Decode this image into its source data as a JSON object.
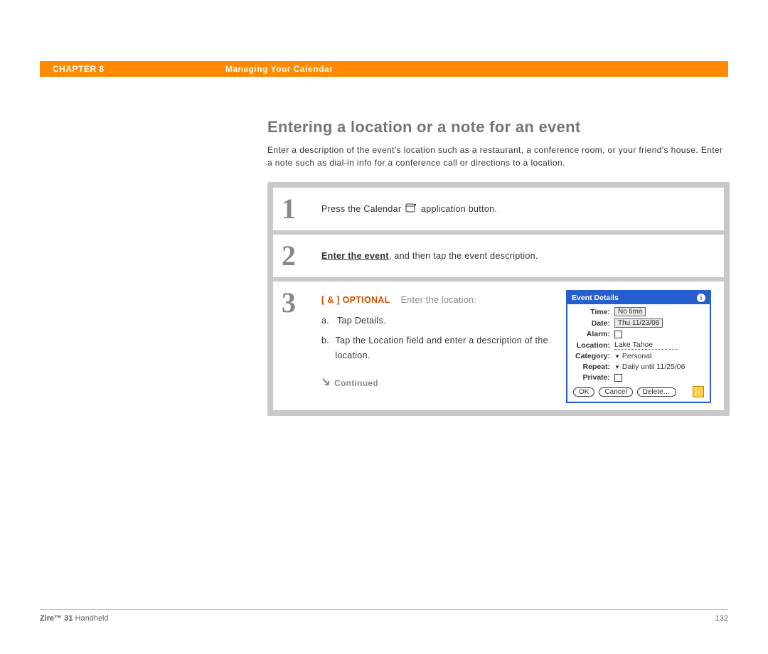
{
  "header": {
    "chapter": "CHAPTER 8",
    "title": "Managing Your Calendar"
  },
  "page": {
    "heading": "Entering a location or a note for an event",
    "intro": "Enter a description of the event's location such as a restaurant, a conference room, or your friend's house. Enter a note such as dial-in info for a conference call or directions to a location."
  },
  "steps": {
    "s1": {
      "num": "1",
      "pre": "Press the Calendar ",
      "post": " application button."
    },
    "s2": {
      "num": "2",
      "link": "Enter the event",
      "rest": ", and then tap the event description."
    },
    "s3": {
      "num": "3",
      "optional": "[ & ]  OPTIONAL",
      "lead": "Enter the location:",
      "a_lab": "a.",
      "a": "Tap Details.",
      "b_lab": "b.",
      "b": "Tap the Location field and enter a description of the location.",
      "continued": "Continued"
    }
  },
  "dialog": {
    "title": "Event Details",
    "rows": {
      "time_l": "Time:",
      "time_v": "No time",
      "date_l": "Date:",
      "date_v": "Thu 11/23/06",
      "alarm_l": "Alarm:",
      "loc_l": "Location:",
      "loc_v": "Lake Tahoe",
      "cat_l": "Category:",
      "cat_v": "Personal",
      "rep_l": "Repeat:",
      "rep_v": "Daily until 11/25/06",
      "priv_l": "Private:"
    },
    "buttons": {
      "ok": "OK",
      "cancel": "Cancel",
      "delete": "Delete…"
    }
  },
  "footer": {
    "product_b": "Zire™ 31",
    "product_r": " Handheld",
    "pagenum": "132"
  }
}
